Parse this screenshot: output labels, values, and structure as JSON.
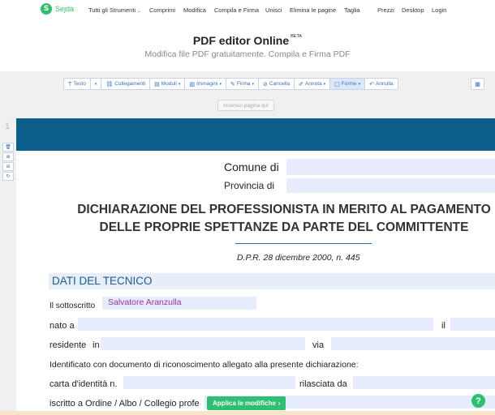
{
  "nav": {
    "logo_text": "Sejda",
    "logo_glyph": "S",
    "items": [
      "Tutti gli Strumenti",
      "Comprimi",
      "Modifica",
      "Compila e Firma",
      "Unisci",
      "Elimina le pagine",
      "Taglia",
      "Prezzi",
      "Desktop",
      "Login"
    ]
  },
  "hero": {
    "title": "PDF editor Online",
    "beta": "BETA",
    "subtitle": "Modifica file PDF gratuitamente. Compila e Firma PDF"
  },
  "toolbar": {
    "items": [
      {
        "icon": "T",
        "label": "Testo"
      },
      {
        "icon": "▾",
        "label": ""
      },
      {
        "icon": "🔗",
        "label": "Collegamenti"
      },
      {
        "icon": "▤",
        "label": "Moduli"
      },
      {
        "icon": "▨",
        "label": "Immagini"
      },
      {
        "icon": "✎",
        "label": "Firma"
      },
      {
        "icon": "⊘",
        "label": "Cancella"
      },
      {
        "icon": "✐",
        "label": "Annota"
      },
      {
        "icon": "□",
        "label": "Forme"
      },
      {
        "icon": "↶",
        "label": "Annulla"
      }
    ],
    "active": "Forme",
    "right_icon": "▦",
    "insert_page": "Inserisci pagina qui"
  },
  "page_number": "1",
  "document": {
    "comune_label": "Comune di",
    "provincia_label": "Provincia di",
    "title_line1": "DICHIARAZIONE DEL PROFESSIONISTA IN MERITO AL PAGAMENTO",
    "title_line2": "DELLE PROPRIE SPETTANZE DA PARTE DEL COMMITTENTE",
    "dpr": "D.P.R. 28 dicembre 2000, n. 445",
    "section_title": "DATI DEL TECNICO",
    "sottoscritto_label": "Il sottoscritto",
    "sottoscritto_value": "Salvatore Aranzulla",
    "nato_label": "nato a",
    "il_label": "il",
    "residente_label": "residente",
    "in_label": "in",
    "via_label": "via",
    "identificato_text": "Identificato con documento di riconoscimento allegato alla presente dichiarazione:",
    "carta_label": "carta d'identità n.",
    "rilasciata_label": "rilasciata da",
    "iscritto_label": "iscritto a Ordine / Albo / Collegio profe"
  },
  "apply_button": "Applica le modifiche",
  "help_glyph": "?",
  "colors": {
    "brand": "#2fbf71",
    "banner": "#0d5e8a",
    "field": "#e6ecfb",
    "value": "#9b2fa8"
  }
}
